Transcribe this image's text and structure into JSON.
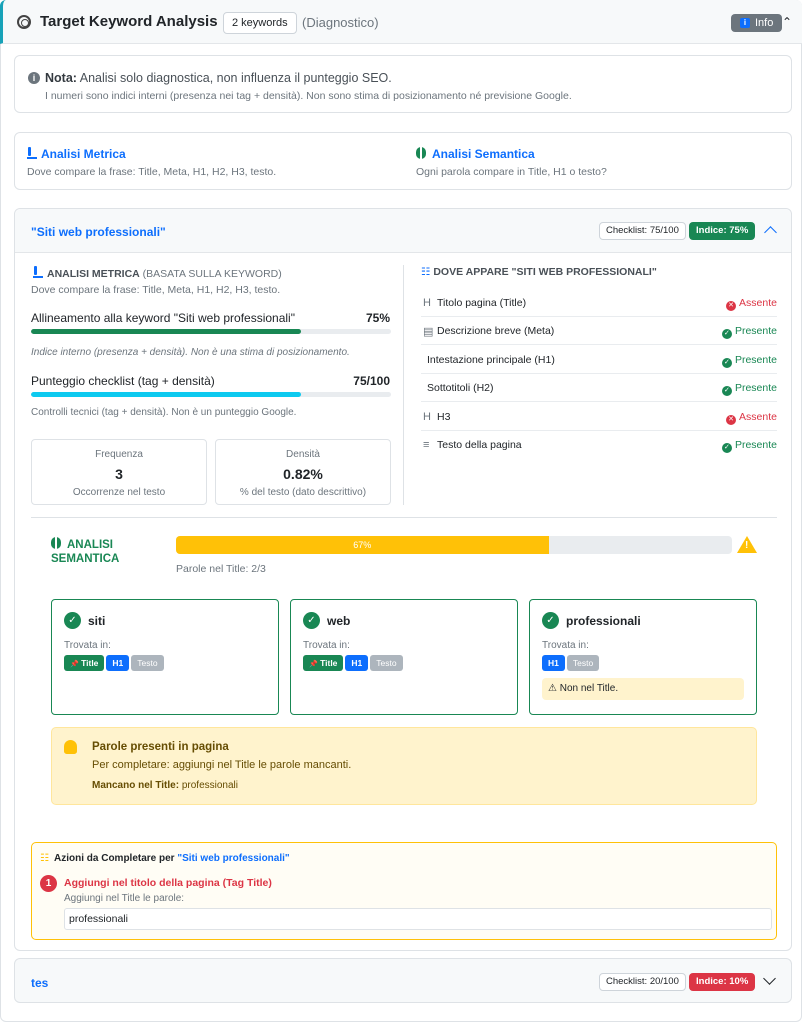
{
  "header": {
    "title": "Target Keyword Analysis",
    "keywords_badge": "2 keywords",
    "diagnostic": "(Diagnostico)",
    "info_label": "Info",
    "info_icon": "i"
  },
  "note": {
    "label": "Nota:",
    "text": "Analisi solo diagnostica, non influenza il punteggio SEO.",
    "detail": "I numeri sono indici interni (presenza nei tag + densità). Non sono stima di posizionamento né previsione Google."
  },
  "overview": {
    "metric_title": "Analisi Metrica",
    "metric_desc": "Dove compare la frase: Title, Meta, H1, H2, H3, testo.",
    "semantic_title": "Analisi Semantica",
    "semantic_desc": "Ogni parola compare in Title, H1 o testo?"
  },
  "keyword1": {
    "title": "\"Siti web professionali\"",
    "checklist_badge": "Checklist: 75/100",
    "index_badge": "Indice: 75%",
    "metric": {
      "heading": "ANALISI METRICA",
      "heading_sub": "(BASATA SULLA KEYWORD)",
      "desc": "Dove compare la frase: Title, Meta, H1, H2, H3, testo.",
      "alignment_label": "Allineamento alla keyword \"Siti web professionali\"",
      "alignment_value": "75%",
      "alignment_fill": 0.75,
      "alignment_note": "Indice interno (presenza + densità). Non è una stima di posizionamento.",
      "checklist_label": "Punteggio checklist (tag + densità)",
      "checklist_value": "75/100",
      "checklist_fill": 0.75,
      "checklist_note": "Controlli tecnici (tag + densità). Non è un punteggio Google.",
      "freq_label": "Frequenza",
      "freq_value": "3",
      "freq_sub": "Occorrenze nel testo",
      "dens_label": "Densità",
      "dens_value": "0.82%",
      "dens_sub": "% del testo (dato descrittivo)"
    },
    "where": {
      "heading": "DOVE APPARE \"SITI WEB PROFESSIONALI\"",
      "rows": [
        {
          "icon": "H",
          "label": "Titolo pagina (Title)",
          "status": "Assente"
        },
        {
          "icon": "▤",
          "label": "Descrizione breve (Meta)",
          "status": "Presente"
        },
        {
          "icon": "",
          "label": "Intestazione principale (H1)",
          "status": "Presente"
        },
        {
          "icon": "",
          "label": "Sottotitoli (H2)",
          "status": "Presente"
        },
        {
          "icon": "H",
          "label": "H3",
          "status": "Assente"
        },
        {
          "icon": "≡",
          "label": "Testo della pagina",
          "status": "Presente"
        }
      ]
    },
    "semantic": {
      "heading_1": "ANALISI",
      "heading_2": "SEMANTICA",
      "progress_label": "67%",
      "progress_fill": 0.67,
      "words_in_title": "Parole nel Title: 2/3",
      "found_in": "Trovata in:",
      "words": [
        {
          "word": "siti",
          "tags": [
            "Title",
            "H1",
            "Testo"
          ]
        },
        {
          "word": "web",
          "tags": [
            "Title",
            "H1",
            "Testo"
          ]
        },
        {
          "word": "professionali",
          "tags": [
            "H1",
            "Testo"
          ],
          "warning": "Non nel Title."
        }
      ],
      "tip_title": "Parole presenti in pagina",
      "tip_text": "Per completare: aggiungi nel Title le parole mancanti.",
      "tip_missing_label": "Mancano nel Title:",
      "tip_missing_value": "professionali"
    },
    "actions": {
      "heading": "Azioni da Completare per",
      "heading_kw": "\"Siti web professionali\"",
      "number": "1",
      "action_title": "Aggiungi nel titolo della pagina (Tag Title)",
      "action_sub": "Aggiungi nel Title le parole:",
      "action_value": "professionali"
    }
  },
  "keyword2": {
    "title": "tes",
    "checklist_badge": "Checklist: 20/100",
    "index_badge": "Indice: 10%"
  },
  "colors": {
    "accent": "#0d6efd",
    "success": "#198754",
    "danger": "#dc3545",
    "warning": "#ffc107",
    "info": "#17a2b8"
  }
}
